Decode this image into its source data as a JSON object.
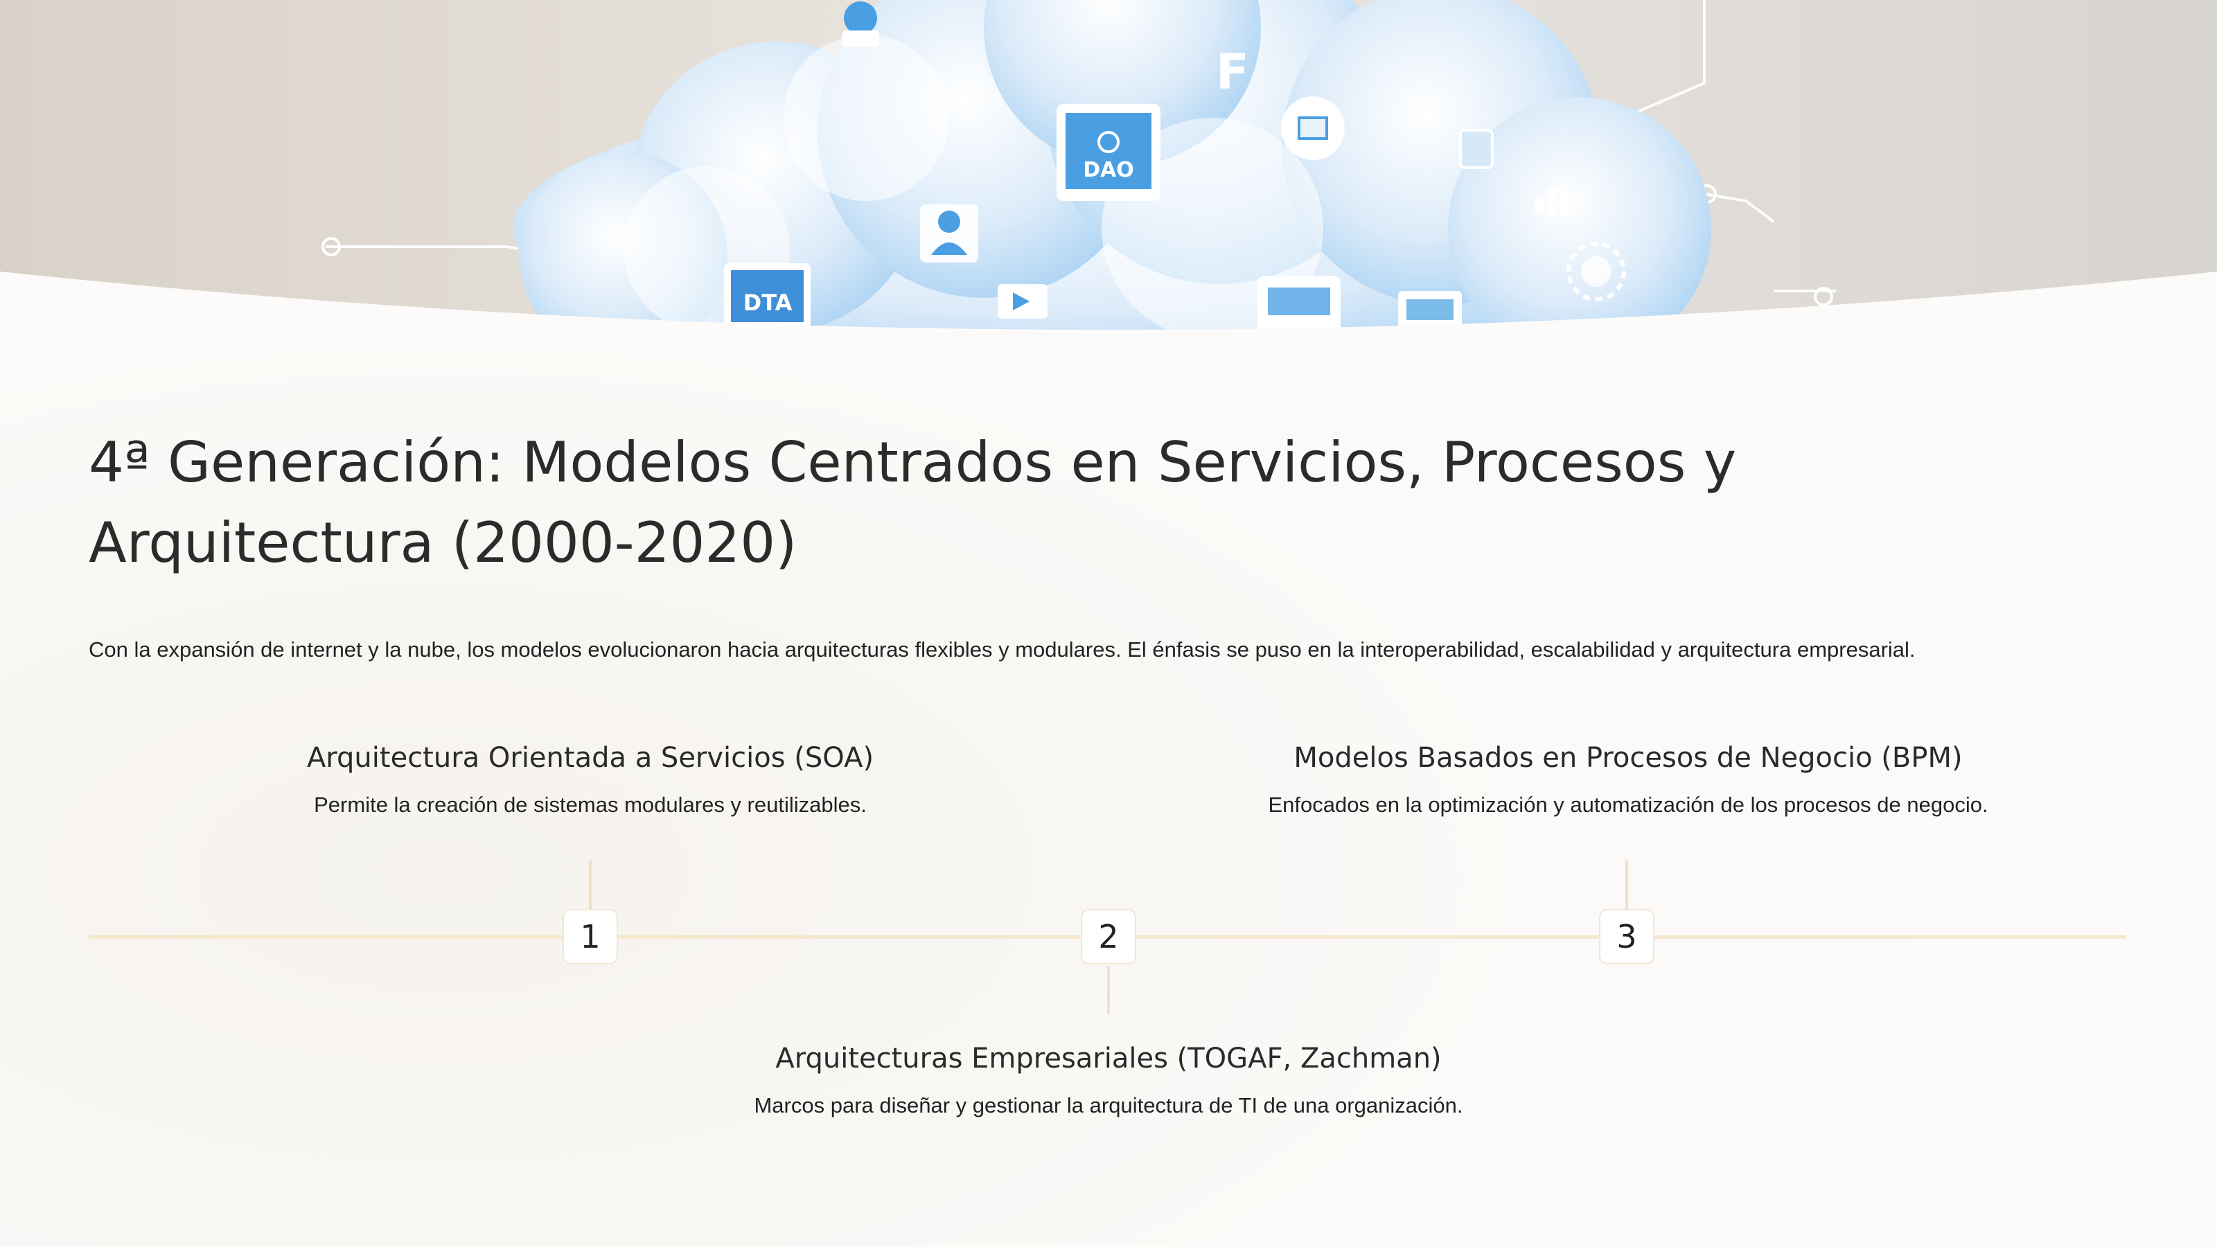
{
  "title": "4ª Generación: Modelos Centrados en Servicios, Procesos y Arquitectura (2000-2020)",
  "intro": "Con la expansión de internet y la nube, los modelos evolucionaron hacia arquitecturas flexibles y modulares. El énfasis se puso en la interoperabilidad, escalabilidad y arquitectura empresarial.",
  "banner": {
    "labels": [
      "DAO",
      "DTA",
      "F"
    ]
  },
  "timeline": [
    {
      "number": "1",
      "heading": "Arquitectura Orientada a Servicios (SOA)",
      "description": "Permite la creación de sistemas modulares y reutilizables."
    },
    {
      "number": "2",
      "heading": "Arquitecturas Empresariales (TOGAF, Zachman)",
      "description": "Marcos para diseñar y gestionar la arquitectura de TI de una organización."
    },
    {
      "number": "3",
      "heading": "Modelos Basados en Procesos de Negocio (BPM)",
      "description": "Enfocados en la optimización y automatización de los procesos de negocio."
    }
  ],
  "colors": {
    "timeline_line": "#f6e7d0",
    "cloud": "#cfe6f8",
    "banner_bg": "#e4ddd3"
  }
}
